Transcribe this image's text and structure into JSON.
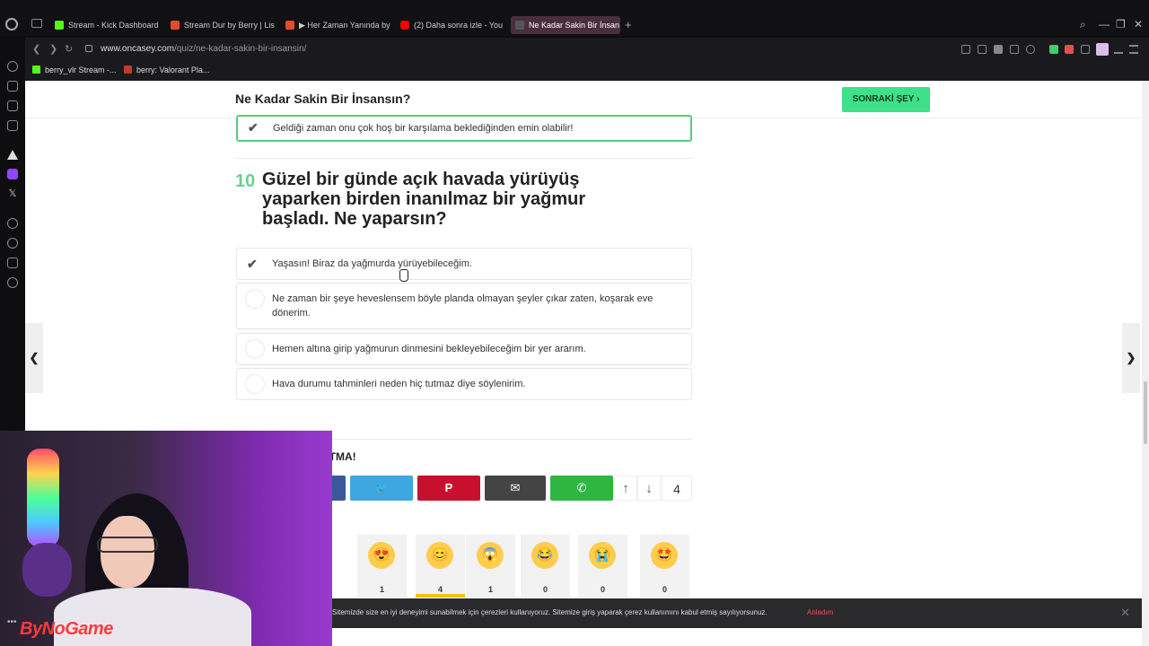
{
  "browser": {
    "tabs": [
      {
        "label": "Stream - Kick Dashboard",
        "color": "#53fc18"
      },
      {
        "label": "Stream Dur by Berry | Lis",
        "color": "#e34b2a"
      },
      {
        "label": "▶ Her Zaman Yanında by",
        "color": "#e34b2a"
      },
      {
        "label": "(2) Daha sonra izle - You",
        "color": "#ff0000"
      },
      {
        "label": "Ne Kadar Sakin Bir İnsan",
        "color": "#555555"
      }
    ],
    "url_domain": "www.oncasey.com",
    "url_path": "/quiz/ne-kadar-sakin-bir-insansin/",
    "bookmarks": [
      {
        "label": "berry_vlr Stream -...",
        "color": "#53fc18"
      },
      {
        "label": "berry: Valorant Pla...",
        "color": "#c0392b"
      }
    ]
  },
  "header": {
    "title": "Ne Kadar Sakin Bir İnsansın?",
    "next_label": "SONRAKİ ŞEY ›"
  },
  "previous_answer": {
    "text": "Geldiği zaman onu çok hoş bir karşılama beklediğinden emin olabilir!"
  },
  "question": {
    "number": "10",
    "text": "Güzel bir günde açık havada yürüyüş yaparken birden inanılmaz bir yağmur başladı. Ne yaparsın?",
    "answers": [
      {
        "text": "Yaşasın! Biraz da yağmurda yürüyebileceğim.",
        "selected": true
      },
      {
        "text": "Ne zaman bir şeye heveslensem böyle planda olmayan şeyler çıkar zaten, koşarak eve dönerim.",
        "selected": false
      },
      {
        "text": "Hemen altına girip yağmurun dinmesini bekleyebileceğim bir yer ararım.",
        "selected": false
      },
      {
        "text": "Hava durumu tahminleri neden hiç tutmaz diye söylenirim.",
        "selected": false
      }
    ]
  },
  "share": {
    "title": "UTMA!",
    "vote_count": "4",
    "twitter_icon": "twitter-icon",
    "colors": {
      "facebook": "#3b5998",
      "twitter": "#3ea6e0",
      "pinterest": "#c8102e",
      "email": "#444444",
      "whatsapp": "#2db742"
    }
  },
  "reactions": [
    {
      "emoji": "😍",
      "count": "1"
    },
    {
      "emoji": "😊",
      "count": "4"
    },
    {
      "emoji": "😱",
      "count": "1"
    },
    {
      "emoji": "😂",
      "count": "0"
    },
    {
      "emoji": "😭",
      "count": "0"
    },
    {
      "emoji": "🤩",
      "count": "0"
    }
  ],
  "cookie": {
    "text": "Sitemizde size en iyi deneyimi sunabilmek için çerezleri kullanıyoruz. Sitemize giriş yaparak çerez kullanımını kabul etmiş sayılıyorsunuz.",
    "accept_label": "Anladım",
    "close": "✕"
  },
  "overlay": {
    "brand": "ByNoGame"
  }
}
